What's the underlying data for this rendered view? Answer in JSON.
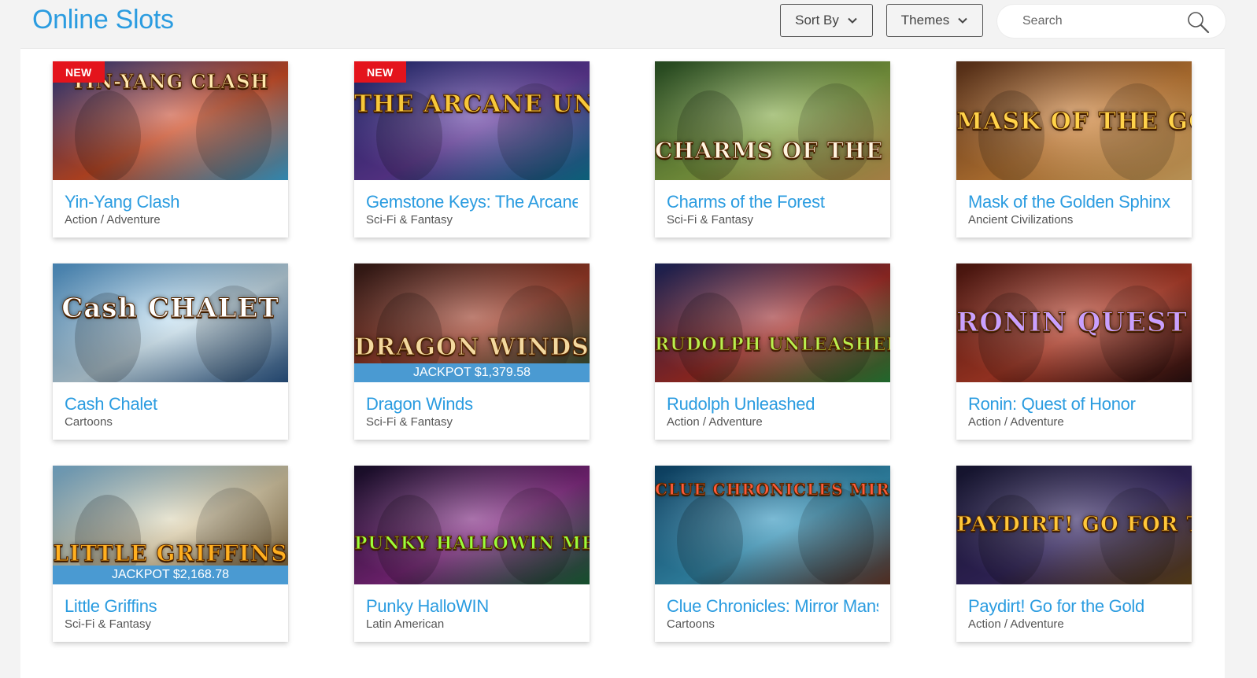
{
  "header": {
    "title": "Online Slots",
    "sort_label": "Sort By",
    "themes_label": "Themes",
    "search_placeholder": "Search"
  },
  "colors": {
    "accent": "#2b9ce0",
    "badge": "#e4141c",
    "jackpot_bar": "#4a9ad2"
  },
  "games": [
    {
      "title": "Yin-Yang Clash",
      "theme": "Action / Adventure",
      "badge": "NEW",
      "jackpot": "",
      "logo": "YIN-YANG CLASH"
    },
    {
      "title": "Gemstone Keys: The Arcane Unlocked",
      "theme": "Sci-Fi & Fantasy",
      "badge": "NEW",
      "jackpot": "",
      "logo": "THE ARCANE UNLOCKED"
    },
    {
      "title": "Charms of the Forest",
      "theme": "Sci-Fi & Fantasy",
      "badge": "",
      "jackpot": "",
      "logo": "CHARMS OF THE FOREST"
    },
    {
      "title": "Mask of the Golden Sphinx",
      "theme": "Ancient Civilizations",
      "badge": "",
      "jackpot": "",
      "logo": "MASK OF THE GOLDEN SPHINX"
    },
    {
      "title": "Cash Chalet",
      "theme": "Cartoons",
      "badge": "",
      "jackpot": "",
      "logo": "Cash CHALET"
    },
    {
      "title": "Dragon Winds",
      "theme": "Sci-Fi & Fantasy",
      "badge": "",
      "jackpot": "JACKPOT $1,379.58",
      "logo": "DRAGON WINDS"
    },
    {
      "title": "Rudolph Unleashed",
      "theme": "Action / Adventure",
      "badge": "",
      "jackpot": "",
      "logo": "RUDOLPH UNLEASHED"
    },
    {
      "title": "Ronin: Quest of Honor",
      "theme": "Action / Adventure",
      "badge": "",
      "jackpot": "",
      "logo": "RONIN QUEST OF HONOR"
    },
    {
      "title": "Little Griffins",
      "theme": "Sci-Fi & Fantasy",
      "badge": "",
      "jackpot": "JACKPOT $2,168.78",
      "logo": "LITTLE GRIFFINS"
    },
    {
      "title": "Punky HalloWIN",
      "theme": "Latin American",
      "badge": "",
      "jackpot": "",
      "logo": "PUNKY HALLOWIN MEGA CASCADE"
    },
    {
      "title": "Clue Chronicles: Mirror Mansion",
      "theme": "Cartoons",
      "badge": "",
      "jackpot": "",
      "logo": "CLUE CHRONICLES MIRROR MANSION"
    },
    {
      "title": "Paydirt! Go for the Gold",
      "theme": "Action / Adventure",
      "badge": "",
      "jackpot": "",
      "logo": "PAYDIRT! GO FOR THE GOLD"
    }
  ]
}
